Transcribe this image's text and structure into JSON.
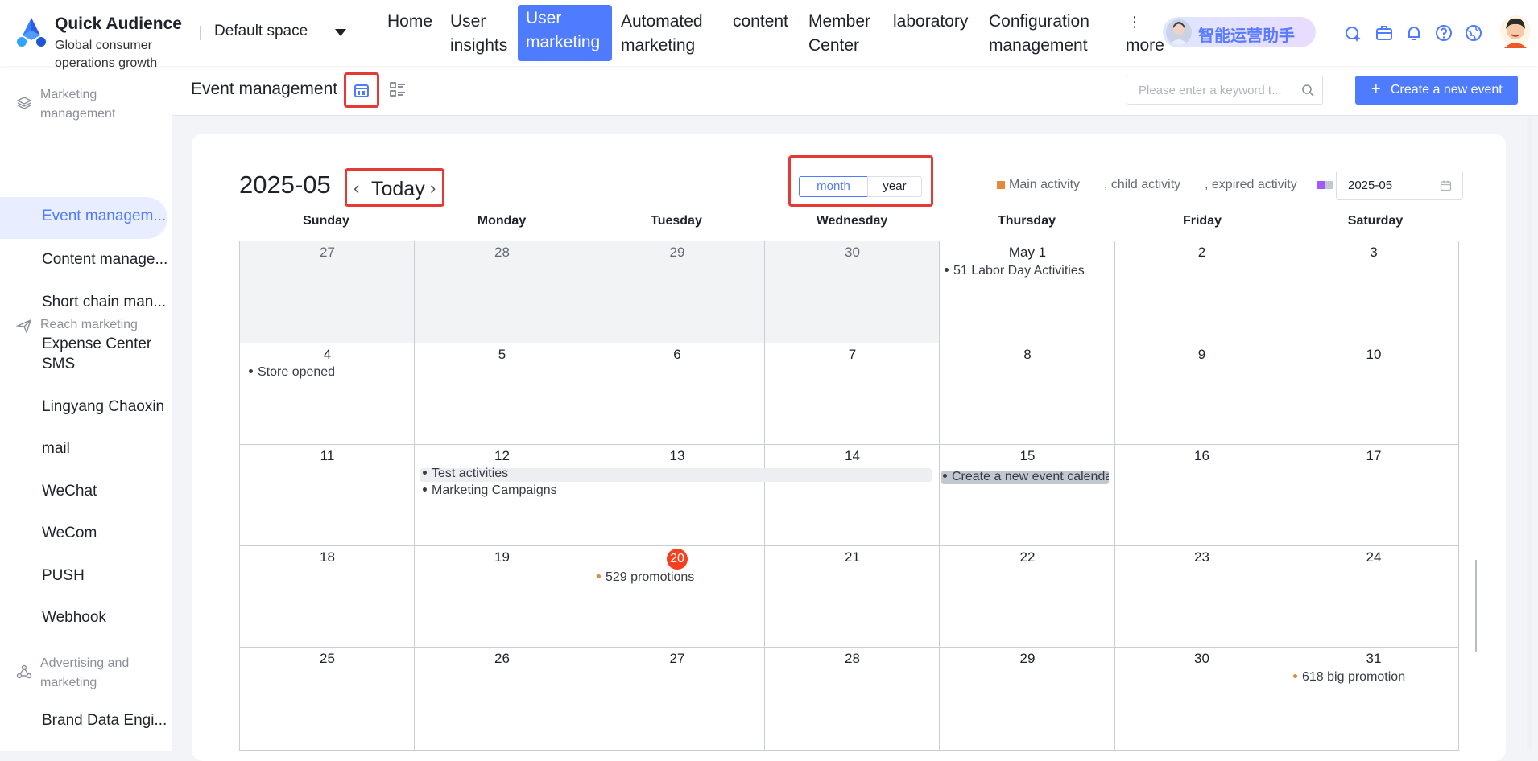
{
  "app": {
    "brand_name": "Quick Audience",
    "brand_sub": "Global consumer operations growth",
    "space": "Default space"
  },
  "nav": {
    "items": [
      {
        "label": "Home"
      },
      {
        "label": "User insights"
      },
      {
        "label": "User marketing",
        "active": true
      },
      {
        "label": "Automated marketing"
      },
      {
        "label": "content"
      },
      {
        "label": "Member Center"
      },
      {
        "label": "laboratory"
      },
      {
        "label": "Configuration management"
      },
      {
        "label": "more",
        "icon": "⋮"
      }
    ],
    "assistant": "智能运营助手",
    "icons": [
      "ai-star-icon",
      "briefcase-icon",
      "bell-icon",
      "help-icon",
      "globe-icon"
    ]
  },
  "sidebar": {
    "groups": [
      {
        "label": "Marketing management",
        "icon": "layers-icon",
        "items": [
          "Event managem...",
          "Content manage...",
          "Short chain man...",
          "Expense Center"
        ]
      },
      {
        "label": "Reach marketing",
        "icon": "send-icon",
        "items": [
          "SMS",
          "Lingyang Chaoxin",
          "mail",
          "WeChat",
          "WeCom",
          "PUSH",
          "Webhook"
        ]
      },
      {
        "label": "Advertising and marketing",
        "icon": "share-icon",
        "items": [
          "Brand Data Engi..."
        ]
      }
    ],
    "active_item": "Event managem..."
  },
  "header": {
    "title": "Event management",
    "search_placeholder": "Please enter a keyword t...",
    "create_label": "Create a new event"
  },
  "calendar": {
    "month_label": "2025-05",
    "today_label": "Today",
    "modes": [
      "month",
      "year"
    ],
    "active_mode": "month",
    "legend": [
      {
        "label": "Main activity",
        "color": "#e8873a"
      },
      {
        "label": ", child activity",
        "color": ""
      },
      {
        "label": ", expired activity",
        "color": ""
      }
    ],
    "legend_swatch_colors": [
      "#a259ff",
      "#c3c7cf"
    ],
    "picker_value": "2025-05",
    "weekdays": [
      "Sunday",
      "Monday",
      "Tuesday",
      "Wednesday",
      "Thursday",
      "Friday",
      "Saturday"
    ],
    "weeks": [
      [
        "27",
        "28",
        "29",
        "30",
        "May 1",
        "2",
        "3"
      ],
      [
        "4",
        "5",
        "6",
        "7",
        "8",
        "9",
        "10"
      ],
      [
        "11",
        "12",
        "13",
        "14",
        "15",
        "16",
        "17"
      ],
      [
        "18",
        "19",
        "20",
        "21",
        "22",
        "23",
        "24"
      ],
      [
        "25",
        "26",
        "27",
        "28",
        "29",
        "30",
        "31"
      ]
    ],
    "today": "20",
    "events": {
      "labor_day": "51 Labor Day Activities",
      "store_opened": "Store opened",
      "test_activities": "Test activities",
      "marketing_campaigns": "Marketing Campaigns",
      "new_event_calendar": "Create a new event calenda",
      "promo_529": "529 promotions",
      "big_promo_618": "618 big promotion"
    }
  }
}
